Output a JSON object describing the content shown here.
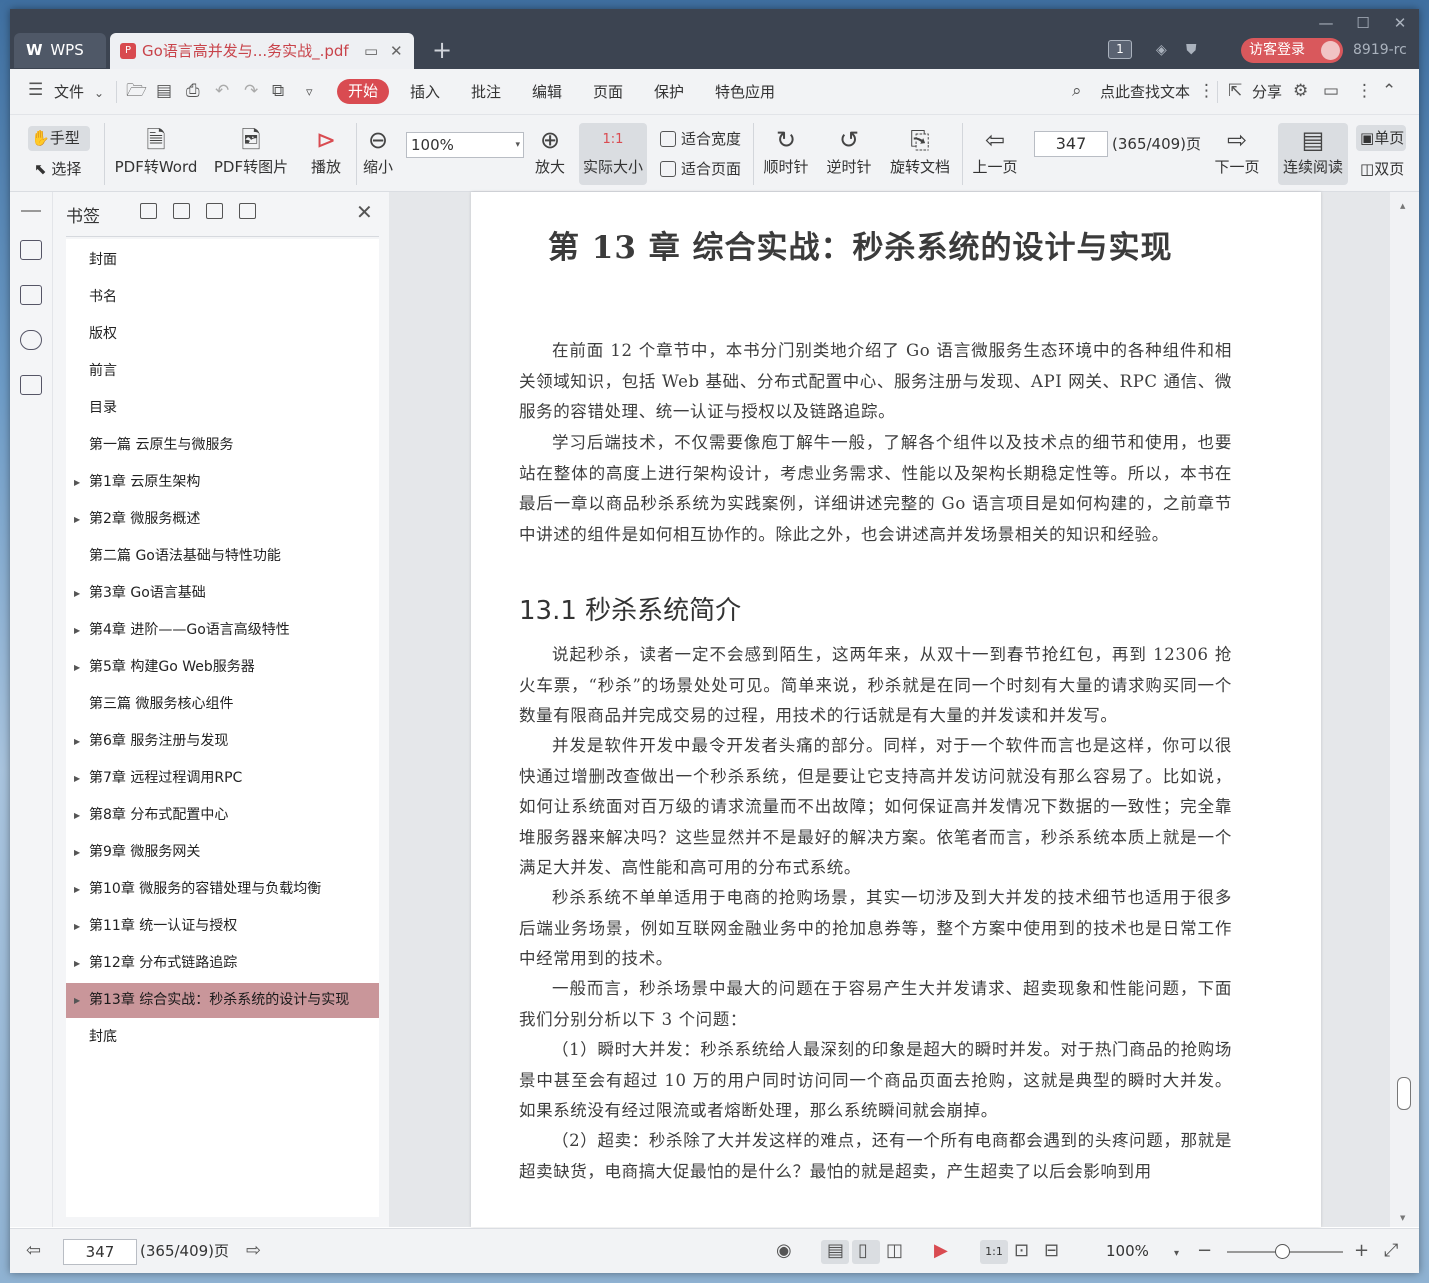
{
  "window": {
    "minimize": "—",
    "maximize": "☐",
    "close": "✕"
  },
  "tabs": [
    {
      "label": "WPS",
      "logo": "W"
    },
    {
      "label": "Go语言高并发与...务实战_.pdf",
      "icon": "P"
    }
  ],
  "titlebar": {
    "counter": "1",
    "login_label": "访客登录",
    "user_id": "8919-rc"
  },
  "menu": {
    "file": "文件",
    "items": [
      "开始",
      "插入",
      "批注",
      "编辑",
      "页面",
      "保护",
      "特色应用"
    ],
    "search": "点此查找文本",
    "share": "分享"
  },
  "toolbar": {
    "hand": "手型",
    "select": "选择",
    "pdf2word": "PDF转Word",
    "pdf2img": "PDF转图片",
    "play": "播放",
    "zoom_out": "缩小",
    "zoom_value": "100%",
    "zoom_in": "放大",
    "actual": "实际大小",
    "actual_icon": "1:1",
    "fit_width": "适合宽度",
    "fit_page": "适合页面",
    "cw": "顺时针",
    "ccw": "逆时针",
    "rotate": "旋转文档",
    "prev": "上一页",
    "page": "347",
    "page_total": "(365/409)页",
    "next": "下一页",
    "continuous": "连续阅读",
    "single": "单页",
    "double": "双页"
  },
  "bookmarks": {
    "title": "书签",
    "items": [
      {
        "label": "封面",
        "expand": false
      },
      {
        "label": "书名",
        "expand": false
      },
      {
        "label": "版权",
        "expand": false
      },
      {
        "label": "前言",
        "expand": false
      },
      {
        "label": "目录",
        "expand": false
      },
      {
        "label": "第一篇  云原生与微服务",
        "expand": false
      },
      {
        "label": "第1章  云原生架构",
        "expand": true
      },
      {
        "label": "第2章  微服务概述",
        "expand": true
      },
      {
        "label": "第二篇  Go语法基础与特性功能",
        "expand": false
      },
      {
        "label": "第3章  Go语言基础",
        "expand": true
      },
      {
        "label": "第4章  进阶——Go语言高级特性",
        "expand": true
      },
      {
        "label": "第5章  构建Go Web服务器",
        "expand": true
      },
      {
        "label": "第三篇  微服务核心组件",
        "expand": false
      },
      {
        "label": "第6章  服务注册与发现",
        "expand": true
      },
      {
        "label": "第7章  远程过程调用RPC",
        "expand": true
      },
      {
        "label": "第8章  分布式配置中心",
        "expand": true
      },
      {
        "label": "第9章  微服务网关",
        "expand": true
      },
      {
        "label": "第10章  微服务的容错处理与负载均衡",
        "expand": true
      },
      {
        "label": "第11章  统一认证与授权",
        "expand": true
      },
      {
        "label": "第12章  分布式链路追踪",
        "expand": true
      },
      {
        "label": "第13章  综合实战：秒杀系统的设计与实现",
        "expand": true,
        "selected": true
      },
      {
        "label": "封底",
        "expand": false
      }
    ]
  },
  "document": {
    "chapter_title": "第 13 章    综合实战：秒杀系统的设计与实现",
    "intro": [
      "在前面 12 个章节中，本书分门别类地介绍了 Go 语言微服务生态环境中的各种组件和相关领域知识，包括 Web 基础、分布式配置中心、服务注册与发现、API 网关、RPC 通信、微服务的容错处理、统一认证与授权以及链路追踪。",
      "学习后端技术，不仅需要像庖丁解牛一般，了解各个组件以及技术点的细节和使用，也要站在整体的高度上进行架构设计，考虑业务需求、性能以及架构长期稳定性等。所以，本书在最后一章以商品秒杀系统为实践案例，详细讲述完整的 Go 语言项目是如何构建的，之前章节中讲述的组件是如何相互协作的。除此之外，也会讲述高并发场景相关的知识和经验。"
    ],
    "section_title": "13.1    秒杀系统简介",
    "body": [
      "说起秒杀，读者一定不会感到陌生，这两年来，从双十一到春节抢红包，再到 12306 抢火车票，“秒杀”的场景处处可见。简单来说，秒杀就是在同一个时刻有大量的请求购买同一个数量有限商品并完成交易的过程，用技术的行话就是有大量的并发读和并发写。",
      "并发是软件开发中最令开发者头痛的部分。同样，对于一个软件而言也是这样，你可以很快通过增删改查做出一个秒杀系统，但是要让它支持高并发访问就没有那么容易了。比如说，如何让系统面对百万级的请求流量而不出故障；如何保证高并发情况下数据的一致性；完全靠堆服务器来解决吗？这些显然并不是最好的解决方案。依笔者而言，秒杀系统本质上就是一个满足大并发、高性能和高可用的分布式系统。",
      "秒杀系统不单单适用于电商的抢购场景，其实一切涉及到大并发的技术细节也适用于很多后端业务场景，例如互联网金融业务中的抢加息券等，整个方案中使用到的技术也是日常工作中经常用到的技术。",
      "一般而言，秒杀场景中最大的问题在于容易产生大并发请求、超卖现象和性能问题，下面我们分别分析以下 3 个问题：",
      "（1）瞬时大并发：秒杀系统给人最深刻的印象是超大的瞬时并发。对于热门商品的抢购场景中甚至会有超过 10 万的用户同时访问同一个商品页面去抢购，这就是典型的瞬时大并发。如果系统没有经过限流或者熔断处理，那么系统瞬间就会崩掉。",
      "（2）超卖：秒杀除了大并发这样的难点，还有一个所有电商都会遇到的头疼问题，那就是超卖缺货，电商搞大促最怕的是什么？最怕的就是超卖，产生超卖了以后会影响到用"
    ]
  },
  "statusbar": {
    "page": "347",
    "page_total": "(365/409)页",
    "zoom": "100%",
    "actual_icon": "1:1"
  }
}
